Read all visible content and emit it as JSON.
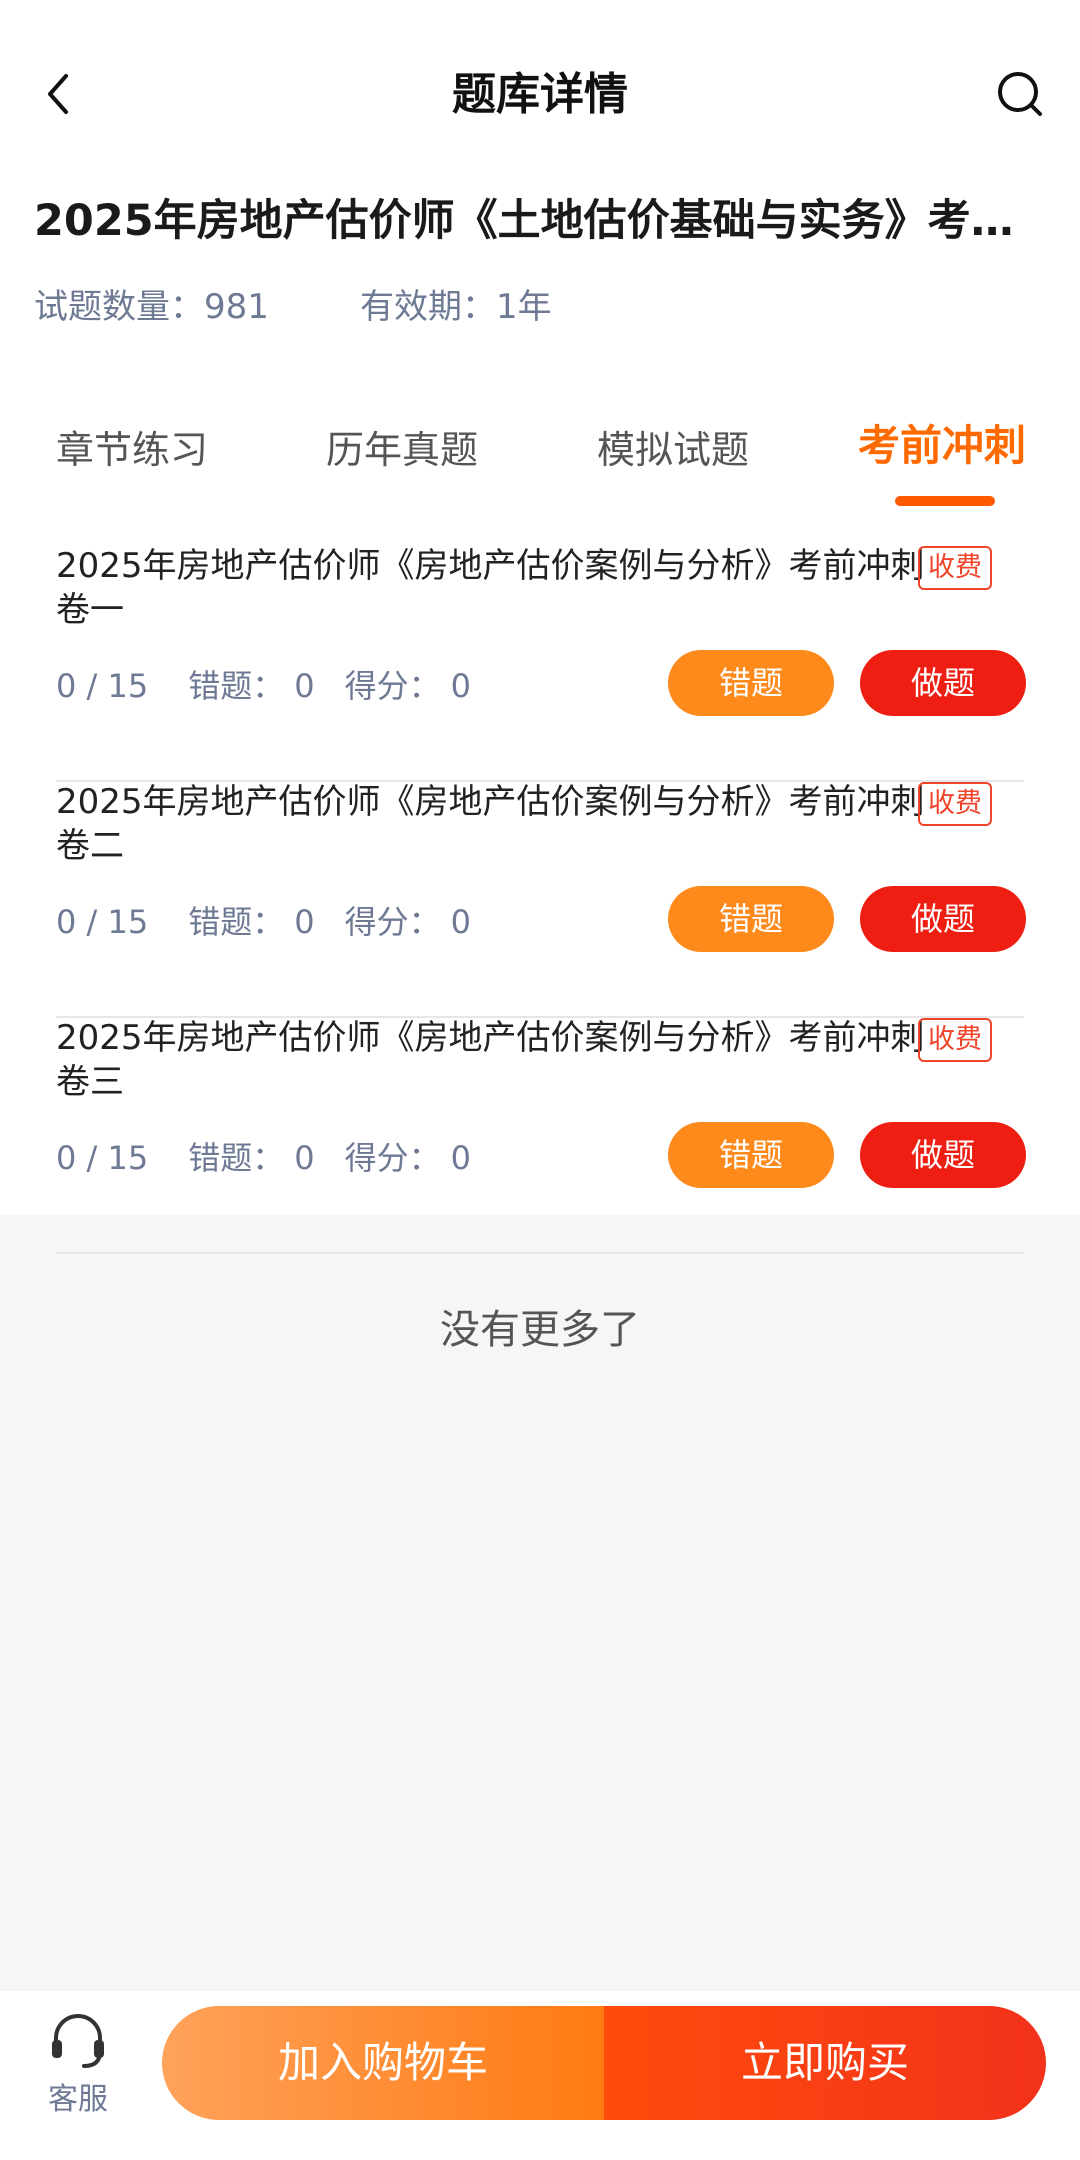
{
  "header": {
    "title": "题库详情",
    "back_icon": "chevron-left-icon",
    "search_icon": "search-icon"
  },
  "bank": {
    "title": "2025年房地产估价师《土地估价基础与实务》考…",
    "question_count_label": "试题数量：981",
    "validity_label": "有效期：1年"
  },
  "tabs": [
    {
      "label": "章节练习",
      "active": false
    },
    {
      "label": "历年真题",
      "active": false
    },
    {
      "label": "模拟试题",
      "active": false
    },
    {
      "label": "考前冲刺",
      "active": true
    }
  ],
  "items": [
    {
      "title": "2025年房地产估价师《房地产估价案例与分析》考前冲刺卷一",
      "tag": "收费",
      "progress": "0 / 15",
      "wrong_label": "错题：",
      "wrong_value": "0",
      "score_label": "得分：",
      "score_value": "0",
      "wrong_button": "错题",
      "do_button": "做题"
    },
    {
      "title": "2025年房地产估价师《房地产估价案例与分析》考前冲刺卷二",
      "tag": "收费",
      "progress": "0 / 15",
      "wrong_label": "错题：",
      "wrong_value": "0",
      "score_label": "得分：",
      "score_value": "0",
      "wrong_button": "错题",
      "do_button": "做题"
    },
    {
      "title": "2025年房地产估价师《房地产估价案例与分析》考前冲刺卷三",
      "tag": "收费",
      "progress": "0 / 15",
      "wrong_label": "错题：",
      "wrong_value": "0",
      "score_label": "得分：",
      "score_value": "0",
      "wrong_button": "错题",
      "do_button": "做题"
    }
  ],
  "list_end_text": "没有更多了",
  "bottom": {
    "service_label": "客服",
    "service_icon": "headset-icon",
    "add_cart_label": "加入购物车",
    "buy_now_label": "立即购买"
  },
  "colors": {
    "accent": "#ff6a00",
    "wrong_button": "#ff8a1c",
    "do_button": "#ee1f12",
    "tag": "#f0442b",
    "meta_text": "#6e7a94"
  }
}
